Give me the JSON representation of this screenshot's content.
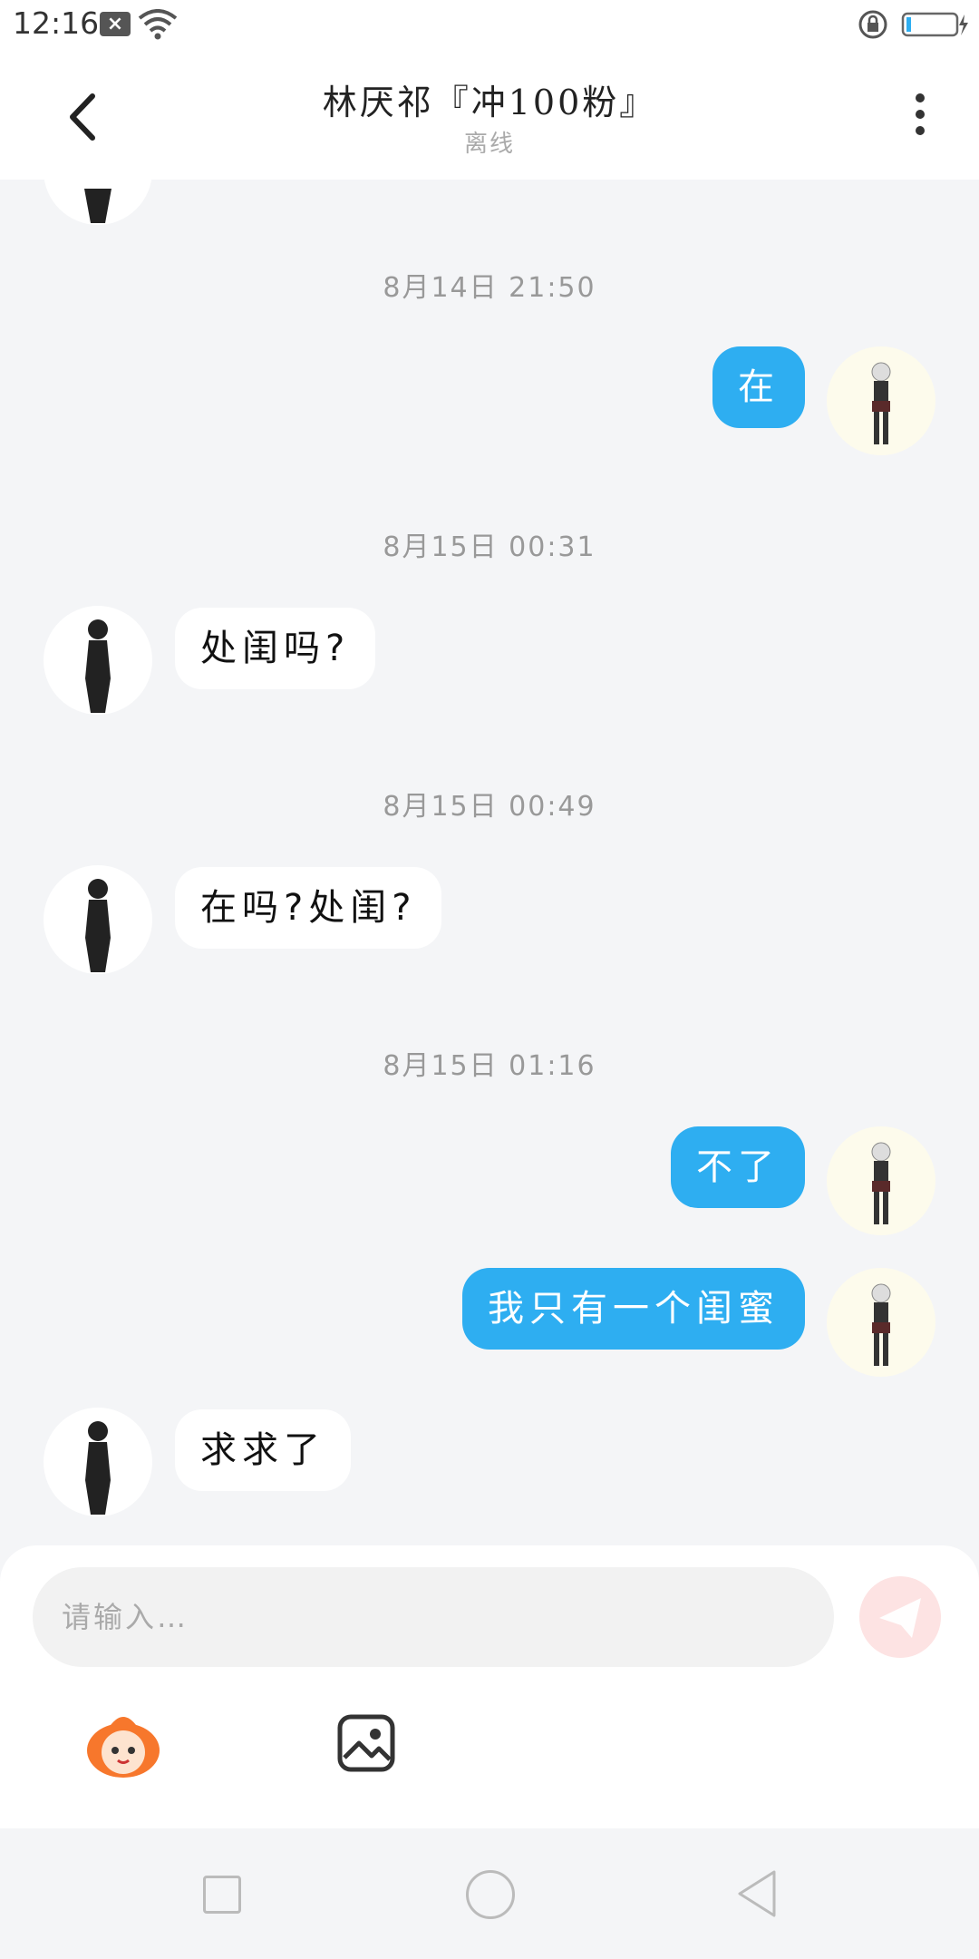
{
  "status_bar": {
    "time": "12:16"
  },
  "header": {
    "title": "林厌祁『冲100粉』",
    "status": "离线"
  },
  "messages": [
    {
      "type": "timestamp",
      "text": "8月14日 21:50"
    },
    {
      "type": "self",
      "text": "在"
    },
    {
      "type": "timestamp",
      "text": "8月15日 00:31"
    },
    {
      "type": "other",
      "text": "处闺吗?"
    },
    {
      "type": "timestamp",
      "text": "8月15日 00:49"
    },
    {
      "type": "other",
      "text": "在吗?处闺?"
    },
    {
      "type": "timestamp",
      "text": "8月15日 01:16"
    },
    {
      "type": "self",
      "text": "不了"
    },
    {
      "type": "self",
      "text": "我只有一个闺蜜"
    },
    {
      "type": "other",
      "text": "求求了"
    }
  ],
  "composer": {
    "placeholder": "请输入…"
  },
  "colors": {
    "self_bubble": "#2eaef1",
    "send_button": "#f47a7a",
    "background": "#f4f5f7"
  }
}
